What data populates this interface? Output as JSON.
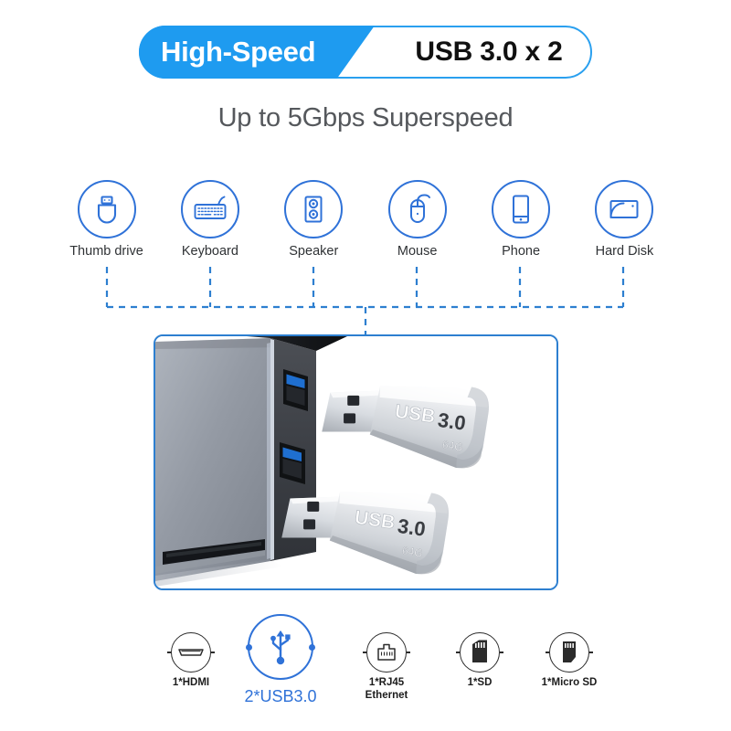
{
  "header": {
    "badge_primary": "High-Speed",
    "badge_secondary": "USB 3.0 x 2",
    "subtitle": "Up to 5Gbps Superspeed",
    "accent_blue": "#1e9bf0",
    "secondary_text_color": "#111111"
  },
  "devices": {
    "items": [
      {
        "label": "Thumb drive",
        "icon": "usb-thumb-drive-icon"
      },
      {
        "label": "Keyboard",
        "icon": "keyboard-icon"
      },
      {
        "label": "Speaker",
        "icon": "speaker-icon"
      },
      {
        "label": "Mouse",
        "icon": "mouse-icon"
      },
      {
        "label": "Phone",
        "icon": "phone-icon"
      },
      {
        "label": "Hard Disk",
        "icon": "hard-disk-icon"
      }
    ],
    "icon_color": "#2f72d8",
    "connector_style": "dashed-bracket"
  },
  "product": {
    "hub_body_color": "#8e949e",
    "port_color": "#1f6fd0",
    "led_color": "#2aa8ff",
    "drive_label_brand": "USB",
    "drive_label_version": "3.0",
    "drive_label_capacity": "64G",
    "drives": [
      {
        "brand": "USB",
        "version": "3.0",
        "capacity": "64G"
      },
      {
        "brand": "USB",
        "version": "3.0",
        "capacity": "64G"
      }
    ],
    "border_color": "#2d7fd0"
  },
  "ports": {
    "accent_color": "#2f72d8",
    "items": [
      {
        "label": "1*HDMI",
        "icon": "hdmi-port-icon",
        "highlighted": false
      },
      {
        "label": "2*USB3.0",
        "icon": "usb-trident-icon",
        "highlighted": true
      },
      {
        "label": "1*RJ45\nEthernet",
        "icon": "rj45-ethernet-icon",
        "highlighted": false
      },
      {
        "label": "1*SD",
        "icon": "sd-card-icon",
        "highlighted": false
      },
      {
        "label": "1*Micro SD",
        "icon": "micro-sd-card-icon",
        "highlighted": false
      }
    ]
  }
}
